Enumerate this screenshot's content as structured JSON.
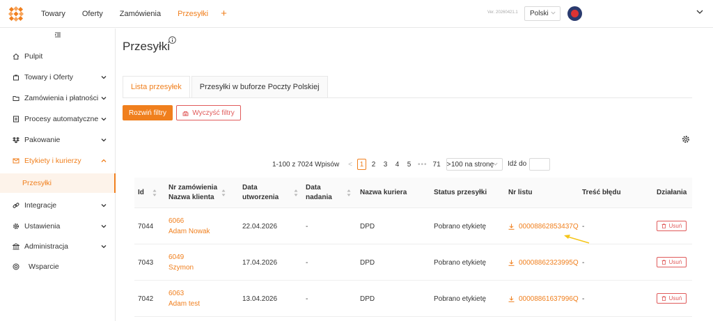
{
  "topbar": {
    "nav": [
      "Towary",
      "Oferty",
      "Zamówienia",
      "Przesyłki"
    ],
    "active_nav": "Przesyłki",
    "add_label": "+",
    "version": "Ver. 20260421.1",
    "language": "Polski"
  },
  "sidebar": {
    "items": [
      {
        "label": "Pulpit",
        "icon": "home-icon"
      },
      {
        "label": "Towary i Oferty",
        "icon": "bag-icon"
      },
      {
        "label": "Zamówienia i płatności",
        "icon": "folder-icon"
      },
      {
        "label": "Procesy automatyczne",
        "icon": "process-icon"
      },
      {
        "label": "Pakowanie",
        "icon": "dropbox-icon"
      },
      {
        "label": "Etykiety i kurierzy",
        "icon": "mail-icon"
      },
      {
        "label": "Integracje",
        "icon": "link-icon"
      },
      {
        "label": "Ustawienia",
        "icon": "gear-icon"
      },
      {
        "label": "Administracja",
        "icon": "bank-icon"
      },
      {
        "label": "Wsparcie",
        "icon": "globe-icon"
      }
    ],
    "sub_item": "Przesyłki"
  },
  "main": {
    "title": "Przesyłki",
    "tabs": [
      "Lista przesyłek",
      "Przesyłki w buforze Poczty Polskiej"
    ],
    "expand_filters": "Rozwiń filtry",
    "clear_filters": "Wyczyść filtry"
  },
  "pagination": {
    "total": "1-100 z 7024 Wpisów",
    "pages": [
      "1",
      "2",
      "3",
      "4",
      "5"
    ],
    "dots": "•••",
    "last": "71",
    "current": "1",
    "per_page": "100 na stronę",
    "goto_label": "Idź do"
  },
  "table": {
    "headers": {
      "id": "Id",
      "order_1": "Nr zamówienia",
      "order_2": "Nazwa klienta",
      "created_1": "Data",
      "created_2": "utworzenia",
      "sent_1": "Data",
      "sent_2": "nadania",
      "courier": "Nazwa kuriera",
      "status": "Status przesyłki",
      "tracking": "Nr listu",
      "error": "Treść błędu",
      "actions": "Działania"
    },
    "rows": [
      {
        "id": "7044",
        "order": "6066",
        "client": "Adam Nowak",
        "created": "22.04.2026",
        "sent": "-",
        "courier": "DPD",
        "status": "Pobrano etykietę",
        "tracking": "00008862853437Q",
        "error": "-",
        "action": "Usuń"
      },
      {
        "id": "7043",
        "order": "6049",
        "client": "Szymon",
        "created": "17.04.2026",
        "sent": "-",
        "courier": "DPD",
        "status": "Pobrano etykietę",
        "tracking": "00008862323995Q",
        "error": "-",
        "action": "Usuń"
      },
      {
        "id": "7042",
        "order": "6063",
        "client": "Adam test",
        "created": "13.04.2026",
        "sent": "-",
        "courier": "DPD",
        "status": "Pobrano etykietę",
        "tracking": "00008861637996Q",
        "error": "-",
        "action": "Usuń"
      }
    ]
  },
  "colors": {
    "accent": "#f07f1d",
    "danger": "#e05a5a",
    "arrow": "#f5c518"
  }
}
